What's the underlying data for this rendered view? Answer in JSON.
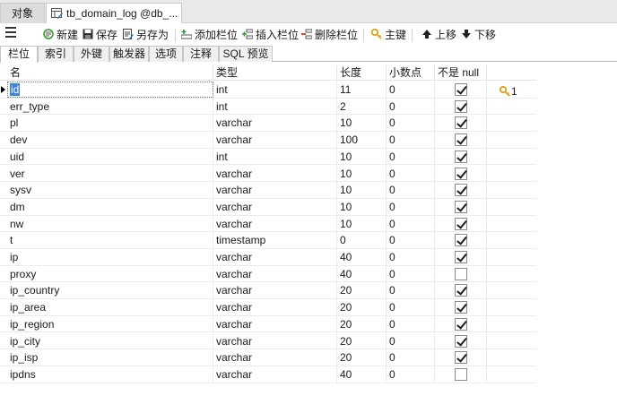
{
  "doc_tabs": {
    "objects": "对象",
    "active": "tb_domain_log @db_..."
  },
  "toolbar": {
    "new": "新建",
    "save": "保存",
    "save_as": "另存为",
    "add_field": "添加栏位",
    "insert_field": "插入栏位",
    "delete_field": "删除栏位",
    "primary_key": "主键",
    "move_up": "上移",
    "move_down": "下移"
  },
  "sub_tabs": [
    "栏位",
    "索引",
    "外键",
    "触发器",
    "选项",
    "注释",
    "SQL 预览"
  ],
  "columns": {
    "name": "名",
    "type": "类型",
    "length": "长度",
    "decimals": "小数点",
    "not_null": "不是 null"
  },
  "rows": [
    {
      "name": "id",
      "type": "int",
      "length": "11",
      "decimals": "0",
      "not_null": true,
      "key": "1"
    },
    {
      "name": "err_type",
      "type": "int",
      "length": "2",
      "decimals": "0",
      "not_null": true,
      "key": ""
    },
    {
      "name": "pl",
      "type": "varchar",
      "length": "10",
      "decimals": "0",
      "not_null": true,
      "key": ""
    },
    {
      "name": "dev",
      "type": "varchar",
      "length": "100",
      "decimals": "0",
      "not_null": true,
      "key": ""
    },
    {
      "name": "uid",
      "type": "int",
      "length": "10",
      "decimals": "0",
      "not_null": true,
      "key": ""
    },
    {
      "name": "ver",
      "type": "varchar",
      "length": "10",
      "decimals": "0",
      "not_null": true,
      "key": ""
    },
    {
      "name": "sysv",
      "type": "varchar",
      "length": "10",
      "decimals": "0",
      "not_null": true,
      "key": ""
    },
    {
      "name": "dm",
      "type": "varchar",
      "length": "10",
      "decimals": "0",
      "not_null": true,
      "key": ""
    },
    {
      "name": "nw",
      "type": "varchar",
      "length": "10",
      "decimals": "0",
      "not_null": true,
      "key": ""
    },
    {
      "name": "t",
      "type": "timestamp",
      "length": "0",
      "decimals": "0",
      "not_null": true,
      "key": ""
    },
    {
      "name": "ip",
      "type": "varchar",
      "length": "40",
      "decimals": "0",
      "not_null": true,
      "key": ""
    },
    {
      "name": "proxy",
      "type": "varchar",
      "length": "40",
      "decimals": "0",
      "not_null": false,
      "key": ""
    },
    {
      "name": "ip_country",
      "type": "varchar",
      "length": "20",
      "decimals": "0",
      "not_null": true,
      "key": ""
    },
    {
      "name": "ip_area",
      "type": "varchar",
      "length": "20",
      "decimals": "0",
      "not_null": true,
      "key": ""
    },
    {
      "name": "ip_region",
      "type": "varchar",
      "length": "20",
      "decimals": "0",
      "not_null": true,
      "key": ""
    },
    {
      "name": "ip_city",
      "type": "varchar",
      "length": "20",
      "decimals": "0",
      "not_null": true,
      "key": ""
    },
    {
      "name": "ip_isp",
      "type": "varchar",
      "length": "20",
      "decimals": "0",
      "not_null": true,
      "key": ""
    },
    {
      "name": "ipdns",
      "type": "varchar",
      "length": "40",
      "decimals": "0",
      "not_null": false,
      "key": ""
    }
  ],
  "icons": {
    "table_tab": "table-design-icon",
    "new": "new-icon",
    "save": "save-icon",
    "save_as": "save-as-icon",
    "add_field": "add-field-icon",
    "insert_field": "insert-field-icon",
    "delete_field": "delete-field-icon",
    "primary_key": "key-icon",
    "move_up": "arrow-up-icon",
    "move_down": "arrow-down-icon"
  },
  "colors": {
    "selection": "#3b83d6",
    "key": "#e0a21a"
  }
}
